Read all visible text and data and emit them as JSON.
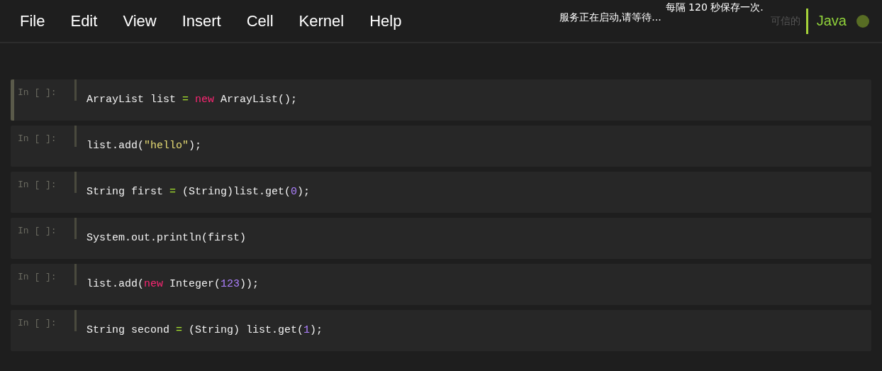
{
  "menu": [
    {
      "label": "File"
    },
    {
      "label": "Edit"
    },
    {
      "label": "View"
    },
    {
      "label": "Insert"
    },
    {
      "label": "Cell"
    },
    {
      "label": "Kernel"
    },
    {
      "label": "Help"
    }
  ],
  "notifications": {
    "status": "服务正在启动,请等待...",
    "autosave": "每隔 120 秒保存一次."
  },
  "trusted": "可信的",
  "kernel": {
    "name": "Java"
  },
  "cells": [
    {
      "prompt": "In [ ]:",
      "selected": true,
      "tokens": [
        {
          "kind": "plain",
          "text": "ArrayList list "
        },
        {
          "kind": "op",
          "text": "="
        },
        {
          "kind": "keyword",
          "text": " new"
        },
        {
          "kind": "plain",
          "text": " ArrayList();"
        }
      ]
    },
    {
      "prompt": "In [ ]:",
      "selected": false,
      "tokens": [
        {
          "kind": "plain",
          "text": "list.add("
        },
        {
          "kind": "string",
          "text": "\"hello\""
        },
        {
          "kind": "plain",
          "text": ");"
        }
      ]
    },
    {
      "prompt": "In [ ]:",
      "selected": false,
      "tokens": [
        {
          "kind": "plain",
          "text": "String first "
        },
        {
          "kind": "op",
          "text": "="
        },
        {
          "kind": "plain",
          "text": " (String)list.get("
        },
        {
          "kind": "number",
          "text": "0"
        },
        {
          "kind": "plain",
          "text": ");"
        }
      ]
    },
    {
      "prompt": "In [ ]:",
      "selected": false,
      "tokens": [
        {
          "kind": "plain",
          "text": "System.out.println(first)"
        }
      ]
    },
    {
      "prompt": "In [ ]:",
      "selected": false,
      "tokens": [
        {
          "kind": "plain",
          "text": "list.add("
        },
        {
          "kind": "keyword",
          "text": "new"
        },
        {
          "kind": "plain",
          "text": " Integer("
        },
        {
          "kind": "number",
          "text": "123"
        },
        {
          "kind": "plain",
          "text": "));"
        }
      ]
    },
    {
      "prompt": "In [ ]:",
      "selected": false,
      "tokens": [
        {
          "kind": "plain",
          "text": "String second "
        },
        {
          "kind": "op",
          "text": "="
        },
        {
          "kind": "plain",
          "text": " (String) list.get("
        },
        {
          "kind": "number",
          "text": "1"
        },
        {
          "kind": "plain",
          "text": ");"
        }
      ]
    }
  ]
}
